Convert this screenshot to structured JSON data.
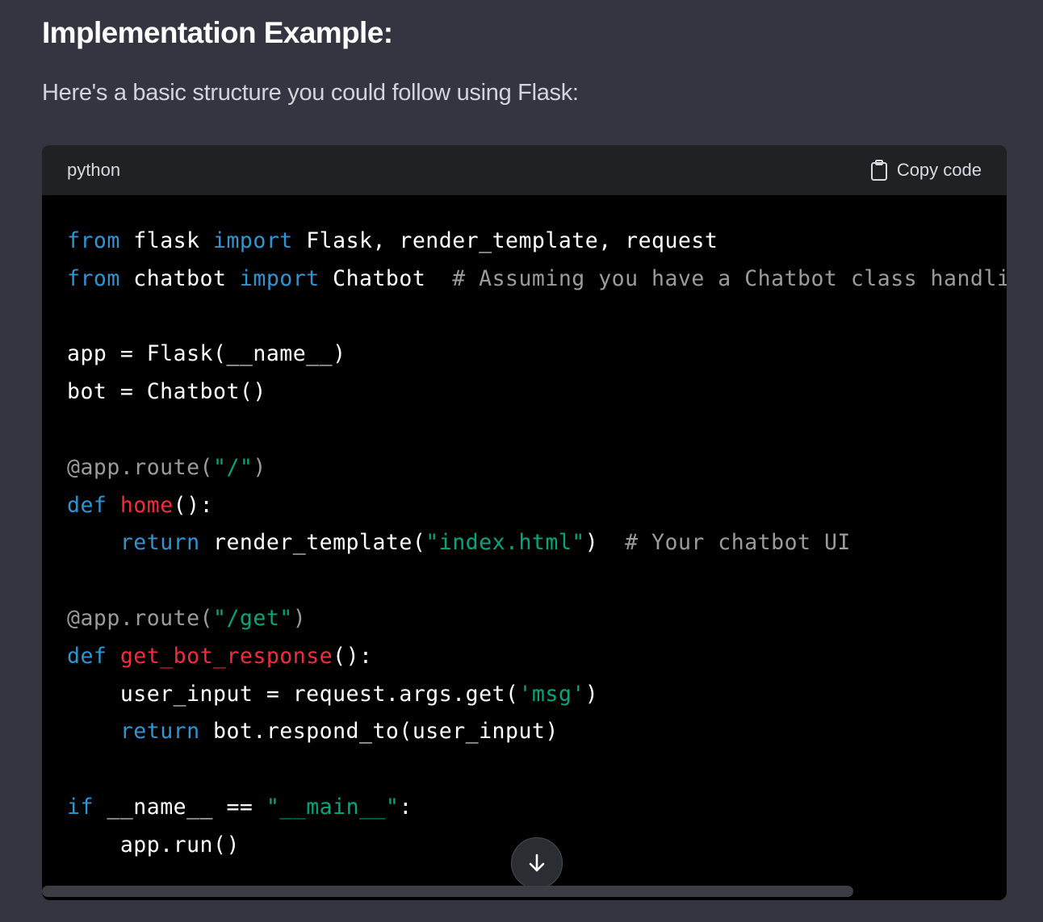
{
  "heading": "Implementation Example:",
  "intro": "Here's a basic structure you could follow using Flask:",
  "code_block": {
    "language": "python",
    "copy_label": "Copy code",
    "colors": {
      "keyword": "#2e95d3",
      "function": "#f22c3d",
      "string": "#00a67d",
      "comment": "#9b9b9b",
      "plain": "#ffffff"
    },
    "lines": [
      [
        {
          "t": "from",
          "k": "keyword"
        },
        {
          "t": " flask ",
          "k": "plain"
        },
        {
          "t": "import",
          "k": "keyword"
        },
        {
          "t": " Flask, render_template, request",
          "k": "plain"
        }
      ],
      [
        {
          "t": "from",
          "k": "keyword"
        },
        {
          "t": " chatbot ",
          "k": "plain"
        },
        {
          "t": "import",
          "k": "keyword"
        },
        {
          "t": " Chatbot  ",
          "k": "plain"
        },
        {
          "t": "# Assuming you have a Chatbot class handli",
          "k": "comment"
        }
      ],
      [],
      [
        {
          "t": "app = Flask(__name__)",
          "k": "plain"
        }
      ],
      [
        {
          "t": "bot = Chatbot()",
          "k": "plain"
        }
      ],
      [],
      [
        {
          "t": "@app.route(",
          "k": "decorator"
        },
        {
          "t": "\"/\"",
          "k": "string"
        },
        {
          "t": ")",
          "k": "decorator"
        }
      ],
      [
        {
          "t": "def",
          "k": "keyword"
        },
        {
          "t": " ",
          "k": "plain"
        },
        {
          "t": "home",
          "k": "func"
        },
        {
          "t": "():",
          "k": "plain"
        }
      ],
      [
        {
          "t": "    ",
          "k": "plain"
        },
        {
          "t": "return",
          "k": "keyword"
        },
        {
          "t": " render_template(",
          "k": "plain"
        },
        {
          "t": "\"index.html\"",
          "k": "string"
        },
        {
          "t": ")  ",
          "k": "plain"
        },
        {
          "t": "# Your chatbot UI",
          "k": "comment"
        }
      ],
      [],
      [
        {
          "t": "@app.route(",
          "k": "decorator"
        },
        {
          "t": "\"/get\"",
          "k": "string"
        },
        {
          "t": ")",
          "k": "decorator"
        }
      ],
      [
        {
          "t": "def",
          "k": "keyword"
        },
        {
          "t": " ",
          "k": "plain"
        },
        {
          "t": "get_bot_response",
          "k": "func"
        },
        {
          "t": "():",
          "k": "plain"
        }
      ],
      [
        {
          "t": "    user_input = request.args.get(",
          "k": "plain"
        },
        {
          "t": "'msg'",
          "k": "string"
        },
        {
          "t": ")",
          "k": "plain"
        }
      ],
      [
        {
          "t": "    ",
          "k": "plain"
        },
        {
          "t": "return",
          "k": "keyword"
        },
        {
          "t": " bot.respond_to(user_input)",
          "k": "plain"
        }
      ],
      [],
      [
        {
          "t": "if",
          "k": "keyword"
        },
        {
          "t": " __name__ == ",
          "k": "plain"
        },
        {
          "t": "\"__main__\"",
          "k": "string"
        },
        {
          "t": ":",
          "k": "plain"
        }
      ],
      [
        {
          "t": "    app.run()",
          "k": "plain"
        }
      ]
    ]
  },
  "icons": {
    "copy": "clipboard-icon",
    "scroll_down": "arrow-down-icon"
  }
}
